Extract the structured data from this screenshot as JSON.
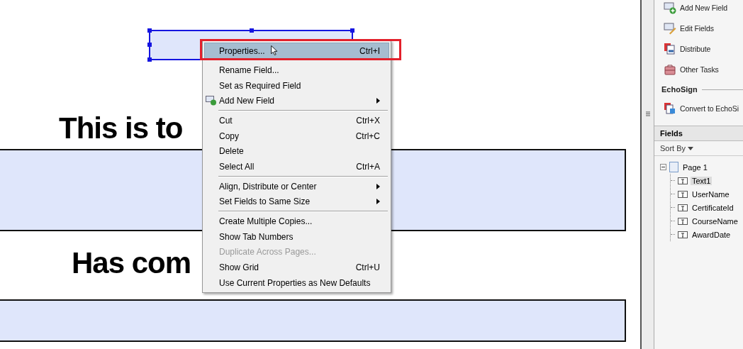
{
  "document": {
    "selected_field": {
      "selected": true
    },
    "heading": "This is to",
    "subheading": "Has com"
  },
  "context_menu": {
    "items": [
      {
        "kind": "item",
        "label": "Properties...",
        "shortcut": "Ctrl+I",
        "selected": true,
        "disabled": false
      },
      {
        "kind": "item",
        "label": "Rename Field...",
        "selected": false,
        "disabled": false
      },
      {
        "kind": "item",
        "label": "Set as Required Field",
        "selected": false,
        "disabled": false
      },
      {
        "kind": "submenu",
        "label": "Add New Field",
        "selected": false,
        "disabled": false,
        "icon": true
      },
      {
        "kind": "separator"
      },
      {
        "kind": "item",
        "label": "Cut",
        "shortcut": "Ctrl+X",
        "selected": false,
        "disabled": false
      },
      {
        "kind": "item",
        "label": "Copy",
        "shortcut": "Ctrl+C",
        "selected": false,
        "disabled": false
      },
      {
        "kind": "item",
        "label": "Delete",
        "selected": false,
        "disabled": false
      },
      {
        "kind": "item",
        "label": "Select All",
        "shortcut": "Ctrl+A",
        "selected": false,
        "disabled": false
      },
      {
        "kind": "separator"
      },
      {
        "kind": "submenu",
        "label": "Align, Distribute or Center",
        "selected": false,
        "disabled": false
      },
      {
        "kind": "submenu",
        "label": "Set Fields to Same Size",
        "selected": false,
        "disabled": false
      },
      {
        "kind": "separator"
      },
      {
        "kind": "item",
        "label": "Create Multiple Copies...",
        "selected": false,
        "disabled": false
      },
      {
        "kind": "item",
        "label": "Show Tab Numbers",
        "selected": false,
        "disabled": false
      },
      {
        "kind": "item",
        "label": "Duplicate Across Pages...",
        "selected": false,
        "disabled": true
      },
      {
        "kind": "item",
        "label": "Show Grid",
        "shortcut": "Ctrl+U",
        "selected": false,
        "disabled": false
      },
      {
        "kind": "item",
        "label": "Use Current Properties as New Defaults",
        "selected": false,
        "disabled": false
      }
    ]
  },
  "tasks": [
    {
      "kind": "add",
      "label": "Add New Field"
    },
    {
      "kind": "edit",
      "label": "Edit Fields"
    },
    {
      "kind": "distribute",
      "label": "Distribute"
    },
    {
      "kind": "other",
      "label": "Other Tasks"
    }
  ],
  "echosign": {
    "title": "EchoSign",
    "items": [
      {
        "kind": "convert",
        "label": "Convert to EchoSi"
      }
    ]
  },
  "fields_panel": {
    "title": "Fields",
    "sort_label": "Sort By",
    "tree": [
      {
        "label": "Page 1",
        "expanded": true,
        "selected": false,
        "children": [
          {
            "label": "Text1",
            "selected": true
          },
          {
            "label": "UserName",
            "selected": false
          },
          {
            "label": "CertificateId",
            "selected": false
          },
          {
            "label": "CourseName",
            "selected": false
          },
          {
            "label": "AwardDate",
            "selected": false
          }
        ]
      }
    ]
  }
}
